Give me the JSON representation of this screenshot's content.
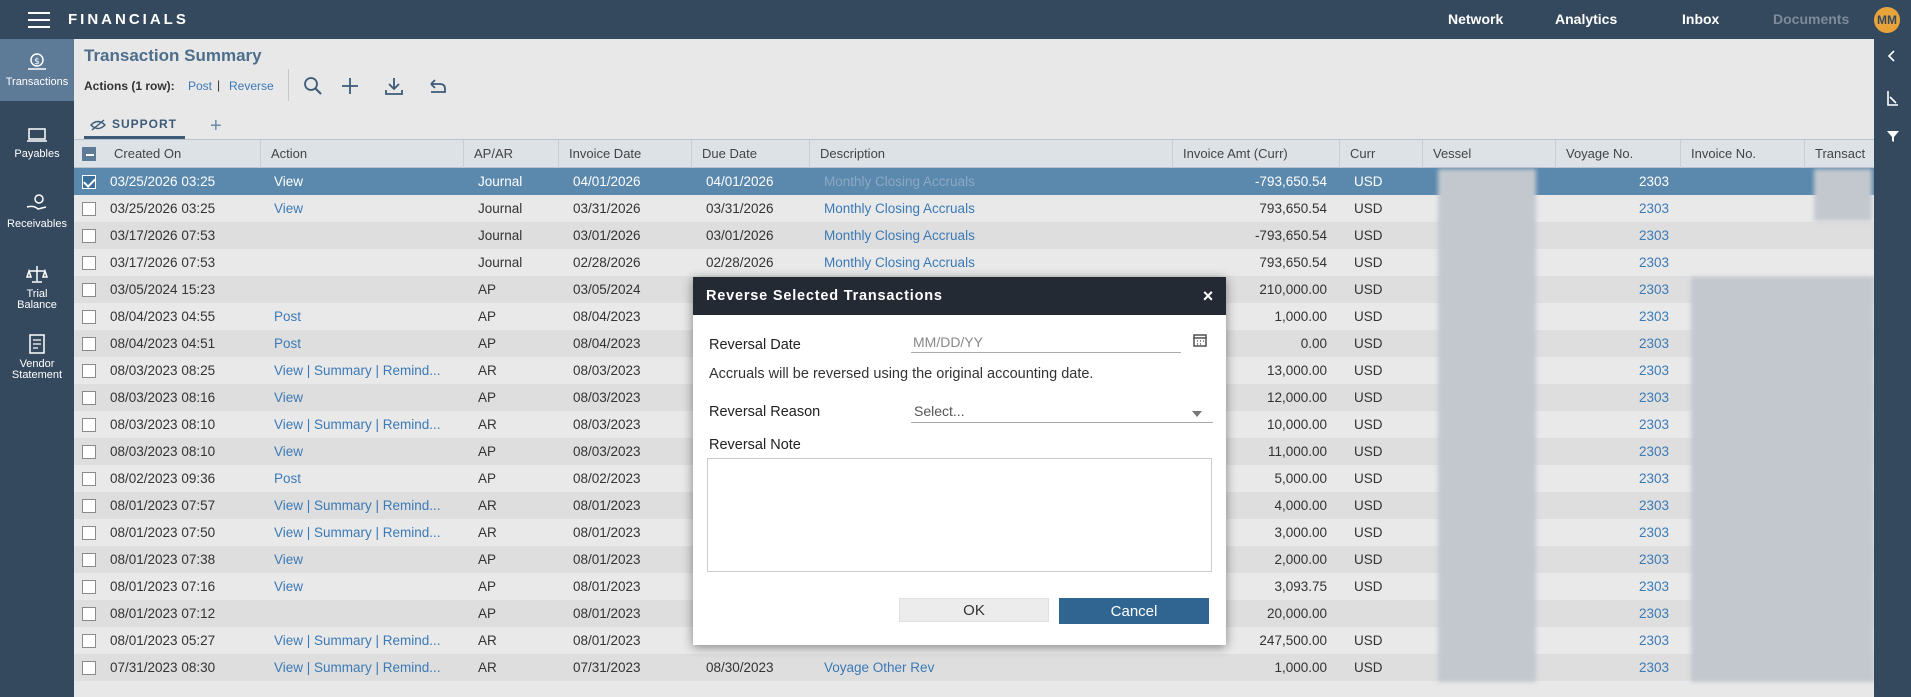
{
  "topbar": {
    "brand": "FINANCIALS",
    "nav": [
      "Network",
      "Analytics",
      "Inbox",
      "Documents"
    ],
    "avatar_initials": "MM"
  },
  "sidebar": {
    "items": [
      {
        "label": "Transactions",
        "icon": "transactions-icon",
        "active": true
      },
      {
        "label": "Payables",
        "icon": "payables-icon",
        "active": false
      },
      {
        "label": "Receivables",
        "icon": "receivables-icon",
        "active": false
      },
      {
        "label": "Trial Balance",
        "icon": "trial-balance-icon",
        "active": false
      },
      {
        "label": "Vendor Statement",
        "icon": "vendor-statement-icon",
        "active": false
      }
    ]
  },
  "page": {
    "title": "Transaction Summary",
    "actions_label": "Actions (1 row):",
    "action_post": "Post",
    "action_sep": "|",
    "action_reverse": "Reverse",
    "tab_label": "SUPPORT"
  },
  "grid": {
    "columns": [
      "Created On",
      "Action",
      "AP/AR",
      "Invoice Date",
      "Due Date",
      "Description",
      "Invoice Amt (Curr)",
      "Curr",
      "Vessel",
      "Voyage No.",
      "Invoice No.",
      "Transact"
    ],
    "rows": [
      {
        "created": "03/25/2026 03:25",
        "action": "View",
        "apar": "Journal",
        "inv": "04/01/2026",
        "due": "04/01/2026",
        "desc": "Monthly Closing Accruals",
        "amt": "-793,650.54",
        "curr": "USD",
        "voy": "2303",
        "selected": true
      },
      {
        "created": "03/25/2026 03:25",
        "action": "View",
        "apar": "Journal",
        "inv": "03/31/2026",
        "due": "03/31/2026",
        "desc": "Monthly Closing Accruals",
        "amt": "793,650.54",
        "curr": "USD",
        "voy": "2303"
      },
      {
        "created": "03/17/2026 07:53",
        "action": "",
        "apar": "Journal",
        "inv": "03/01/2026",
        "due": "03/01/2026",
        "desc": "Monthly Closing Accruals",
        "amt": "-793,650.54",
        "curr": "USD",
        "voy": "2303"
      },
      {
        "created": "03/17/2026 07:53",
        "action": "",
        "apar": "Journal",
        "inv": "02/28/2026",
        "due": "02/28/2026",
        "desc": "Monthly Closing Accruals",
        "amt": "793,650.54",
        "curr": "USD",
        "voy": "2303"
      },
      {
        "created": "03/05/2024 15:23",
        "action": "",
        "apar": "AP",
        "inv": "03/05/2024",
        "due": "",
        "desc": "",
        "amt": "210,000.00",
        "curr": "USD",
        "voy": "2303"
      },
      {
        "created": "08/04/2023 04:55",
        "action": "Post",
        "apar": "AP",
        "inv": "08/04/2023",
        "due": "",
        "desc": "",
        "amt": "1,000.00",
        "curr": "USD",
        "voy": "2303"
      },
      {
        "created": "08/04/2023 04:51",
        "action": "Post",
        "apar": "AP",
        "inv": "08/04/2023",
        "due": "",
        "desc": "",
        "amt": "0.00",
        "curr": "USD",
        "voy": "2303"
      },
      {
        "created": "08/03/2023 08:25",
        "action": "View | Summary | Remind...",
        "apar": "AR",
        "inv": "08/03/2023",
        "due": "",
        "desc": "",
        "amt": "13,000.00",
        "curr": "USD",
        "voy": "2303"
      },
      {
        "created": "08/03/2023 08:16",
        "action": "View",
        "apar": "AP",
        "inv": "08/03/2023",
        "due": "",
        "desc": "",
        "amt": "12,000.00",
        "curr": "USD",
        "voy": "2303"
      },
      {
        "created": "08/03/2023 08:10",
        "action": "View | Summary | Remind...",
        "apar": "AR",
        "inv": "08/03/2023",
        "due": "",
        "desc": "",
        "amt": "10,000.00",
        "curr": "USD",
        "voy": "2303"
      },
      {
        "created": "08/03/2023 08:10",
        "action": "View",
        "apar": "AP",
        "inv": "08/03/2023",
        "due": "",
        "desc": "",
        "amt": "11,000.00",
        "curr": "USD",
        "voy": "2303"
      },
      {
        "created": "08/02/2023 09:36",
        "action": "Post",
        "apar": "AP",
        "inv": "08/02/2023",
        "due": "",
        "desc": "",
        "amt": "5,000.00",
        "curr": "USD",
        "voy": "2303"
      },
      {
        "created": "08/01/2023 07:57",
        "action": "View | Summary | Remind...",
        "apar": "AR",
        "inv": "08/01/2023",
        "due": "",
        "desc": "",
        "amt": "4,000.00",
        "curr": "USD",
        "voy": "2303"
      },
      {
        "created": "08/01/2023 07:50",
        "action": "View | Summary | Remind...",
        "apar": "AR",
        "inv": "08/01/2023",
        "due": "",
        "desc": "",
        "amt": "3,000.00",
        "curr": "USD",
        "voy": "2303"
      },
      {
        "created": "08/01/2023 07:38",
        "action": "View",
        "apar": "AP",
        "inv": "08/01/2023",
        "due": "",
        "desc": "",
        "amt": "2,000.00",
        "curr": "USD",
        "voy": "2303"
      },
      {
        "created": "08/01/2023 07:16",
        "action": "View",
        "apar": "AP",
        "inv": "08/01/2023",
        "due": "",
        "desc": "",
        "amt": "3,093.75",
        "curr": "USD",
        "voy": "2303"
      },
      {
        "created": "08/01/2023 07:12",
        "action": "",
        "apar": "AP",
        "inv": "08/01/2023",
        "due": "",
        "desc": "",
        "amt": "20,000.00",
        "curr": "",
        "voy": "2303"
      },
      {
        "created": "08/01/2023 05:27",
        "action": "View | Summary | Remind...",
        "apar": "AR",
        "inv": "08/01/2023",
        "due": "",
        "desc": "",
        "amt": "247,500.00",
        "curr": "USD",
        "voy": "2303"
      },
      {
        "created": "07/31/2023 08:30",
        "action": "View | Summary | Remind...",
        "apar": "AR",
        "inv": "07/31/2023",
        "due": "08/30/2023",
        "desc": "Voyage Other Rev",
        "amt": "1,000.00",
        "curr": "USD",
        "voy": "2303"
      }
    ]
  },
  "modal": {
    "title": "Reverse Selected Transactions",
    "close": "×",
    "reversal_date_label": "Reversal Date",
    "reversal_date_placeholder": "MM/DD/YY",
    "info_text": "Accruals will be reversed using the original accounting date.",
    "reversal_reason_label": "Reversal Reason",
    "reversal_reason_value": "Select...",
    "reversal_note_label": "Reversal Note",
    "ok_label": "OK",
    "cancel_label": "Cancel"
  }
}
